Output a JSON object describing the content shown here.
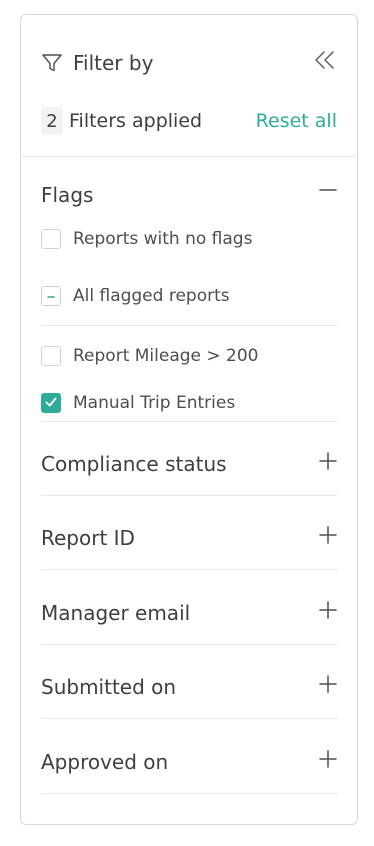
{
  "header": {
    "title": "Filter by",
    "filter_icon": "filter-funnel-icon",
    "collapse_icon": "double-chevron-left-icon"
  },
  "applied": {
    "count": "2",
    "text": "Filters applied",
    "reset_label": "Reset all"
  },
  "flags": {
    "title": "Flags",
    "toggle_icon": "minus-icon",
    "options": [
      {
        "label": "Reports with no flags",
        "state": "unchecked"
      },
      {
        "label": "All flagged reports",
        "state": "indeterminate"
      },
      {
        "label": "Report Mileage > 200",
        "state": "unchecked"
      },
      {
        "label": "Manual Trip Entries",
        "state": "checked"
      }
    ]
  },
  "sections": [
    {
      "label": "Compliance status",
      "icon": "plus-icon"
    },
    {
      "label": "Report ID",
      "icon": "plus-icon"
    },
    {
      "label": "Manager email",
      "icon": "plus-icon"
    },
    {
      "label": "Submitted on",
      "icon": "plus-icon"
    },
    {
      "label": "Approved on",
      "icon": "plus-icon"
    }
  ],
  "colors": {
    "accent": "#2fac99",
    "text": "#3c3f44",
    "border": "#d6d9dc",
    "divider": "#e5e7ea"
  }
}
